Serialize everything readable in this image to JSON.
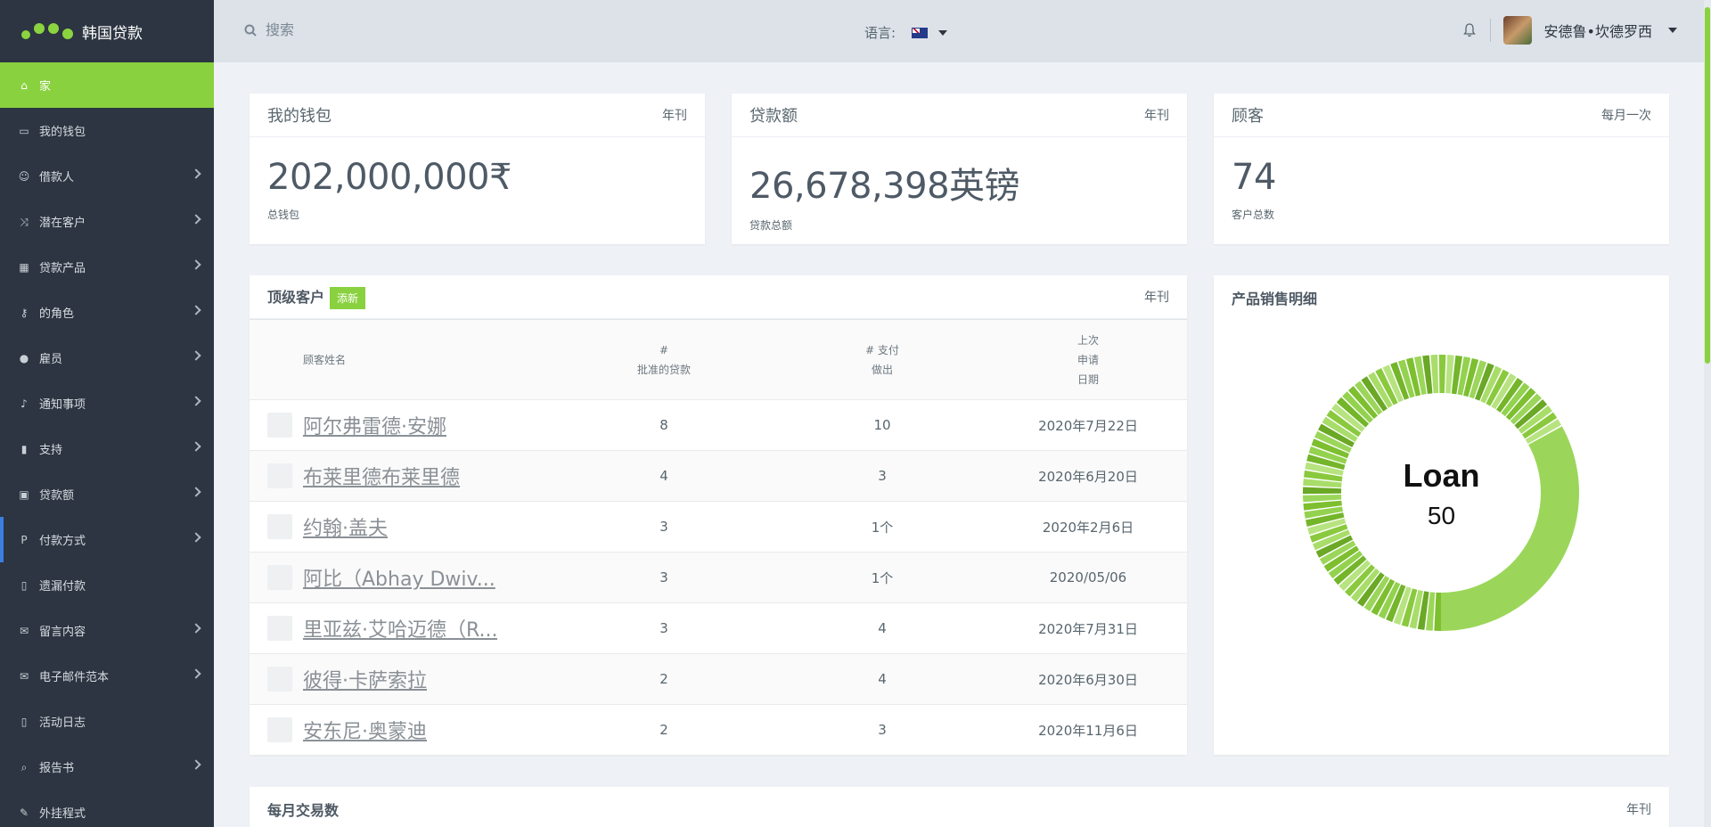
{
  "brand": {
    "name": "韩国贷款",
    "accent": "#8ad13f"
  },
  "sidebar": {
    "items": [
      {
        "label": "家",
        "icon": "home-icon",
        "active": true,
        "has_children": false
      },
      {
        "label": "我的钱包",
        "icon": "briefcase-icon",
        "has_children": false
      },
      {
        "label": "借款人",
        "icon": "smile-icon",
        "has_children": true
      },
      {
        "label": "潜在客户",
        "icon": "shuffle-icon",
        "has_children": true
      },
      {
        "label": "贷款产品",
        "icon": "table-icon",
        "has_children": true
      },
      {
        "label": "的角色",
        "icon": "key-icon",
        "has_children": true
      },
      {
        "label": "雇员",
        "icon": "users-icon",
        "has_children": true
      },
      {
        "label": "通知事项",
        "icon": "bell-icon",
        "has_children": true
      },
      {
        "label": "支持",
        "icon": "bookmark-icon",
        "has_children": true
      },
      {
        "label": "贷款额",
        "icon": "money-icon",
        "has_children": true
      },
      {
        "label": "付款方式",
        "icon": "paypal-icon",
        "has_children": true
      },
      {
        "label": "遗漏付款",
        "icon": "file-icon",
        "has_children": false
      },
      {
        "label": "留言内容",
        "icon": "envelope-icon",
        "has_children": true
      },
      {
        "label": "电子邮件范本",
        "icon": "envelope-icon",
        "has_children": true
      },
      {
        "label": "活动日志",
        "icon": "file-icon",
        "has_children": false
      },
      {
        "label": "报告书",
        "icon": "search-icon",
        "has_children": true
      },
      {
        "label": "外挂程式",
        "icon": "wrench-icon",
        "has_children": false
      }
    ]
  },
  "topbar": {
    "search_placeholder": "搜索",
    "language_label": "语言:",
    "language_flag": "australia-flag-icon",
    "user_name": "安德鲁•坎德罗西"
  },
  "stats": [
    {
      "title": "我的钱包",
      "period": "年刊",
      "value": "202,000,000₹",
      "label": "总钱包"
    },
    {
      "title": "贷款额",
      "period": "年刊",
      "value": "26,678,398英镑",
      "label": "贷款总额"
    },
    {
      "title": "顾客",
      "period": "每月一次",
      "value": "74",
      "label": "客户总数"
    }
  ],
  "top_customers": {
    "title": "顶级客户",
    "badge": "添新",
    "period": "年刊",
    "columns": [
      [
        "顾客姓名"
      ],
      [
        "#",
        "批准的贷款"
      ],
      [
        "# 支付",
        "做出"
      ],
      [
        "上次",
        "申请",
        "日期"
      ]
    ],
    "rows": [
      {
        "name": "阿尔弗雷德·安娜",
        "approved": "8",
        "payments": "10",
        "date": "2020年7月22日"
      },
      {
        "name": "布莱里德布莱里德",
        "approved": "4",
        "payments": "3",
        "date": "2020年6月20日"
      },
      {
        "name": "约翰·盖夫",
        "approved": "3",
        "payments": "1个",
        "date": "2020年2月6日"
      },
      {
        "name": "阿比（Abhay Dwiv...",
        "approved": "3",
        "payments": "1个",
        "date": "2020/05/06"
      },
      {
        "name": "里亚兹·艾哈迈德（R...",
        "approved": "3",
        "payments": "4",
        "date": "2020年7月31日"
      },
      {
        "name": "彼得·卡萨索拉",
        "approved": "2",
        "payments": "4",
        "date": "2020年6月30日"
      },
      {
        "name": "安东尼·奥蒙迪",
        "approved": "2",
        "payments": "3",
        "date": "2020年11月6日"
      }
    ]
  },
  "product_sales": {
    "title": "产品销售明细",
    "center_label": "Loan",
    "center_value": "50"
  },
  "monthly": {
    "title": "每月交易数",
    "period": "年刊"
  },
  "colors": {
    "sidebar_bg": "#2c3541",
    "topbar_bg": "#dde2e8",
    "page_bg": "#eef1f5",
    "accent": "#8ad13f",
    "active_marker": "#3a7ee0"
  }
}
